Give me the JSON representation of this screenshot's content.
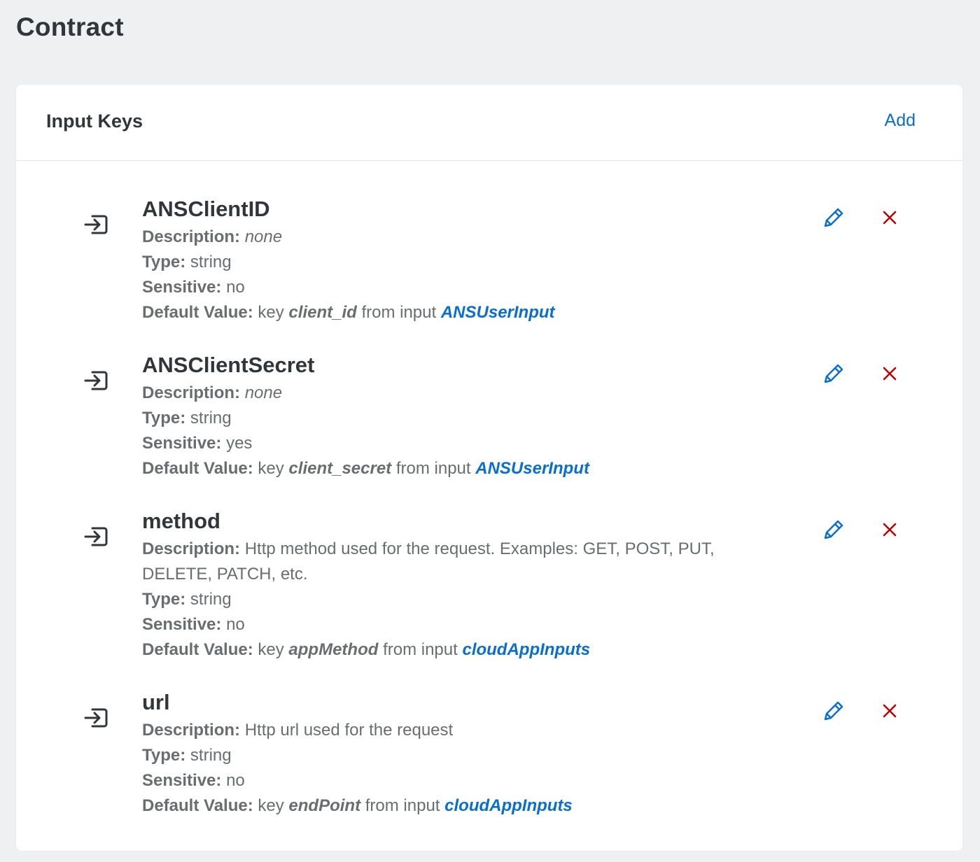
{
  "page": {
    "title": "Contract"
  },
  "card": {
    "title": "Input Keys",
    "add_label": "Add"
  },
  "labels": {
    "description": "Description:",
    "type": "Type:",
    "sensitive": "Sensitive:",
    "default_value": "Default Value:",
    "key_word": "key",
    "from_input": "from input"
  },
  "entries": [
    {
      "name": "ANSClientID",
      "description": "none",
      "type": "string",
      "sensitive": "no",
      "default_key": "client_id",
      "default_input": "ANSUserInput"
    },
    {
      "name": "ANSClientSecret",
      "description": "none",
      "type": "string",
      "sensitive": "yes",
      "default_key": "client_secret",
      "default_input": "ANSUserInput"
    },
    {
      "name": "method",
      "description": "Http method used for the request. Examples: GET, POST, PUT, DELETE, PATCH, etc.",
      "type": "string",
      "sensitive": "no",
      "default_key": "appMethod",
      "default_input": "cloudAppInputs"
    },
    {
      "name": "url",
      "description": "Http url used for the request",
      "type": "string",
      "sensitive": "no",
      "default_key": "endPoint",
      "default_input": "cloudAppInputs"
    }
  ],
  "colors": {
    "accent": "#0a6ed1",
    "delete": "#bb0000",
    "text": "#32363a",
    "muted_text": "#6a6d70",
    "background": "#eff0f2"
  },
  "icons": {
    "entry": "log-in-icon",
    "edit": "pencil-icon",
    "delete": "close-icon"
  }
}
